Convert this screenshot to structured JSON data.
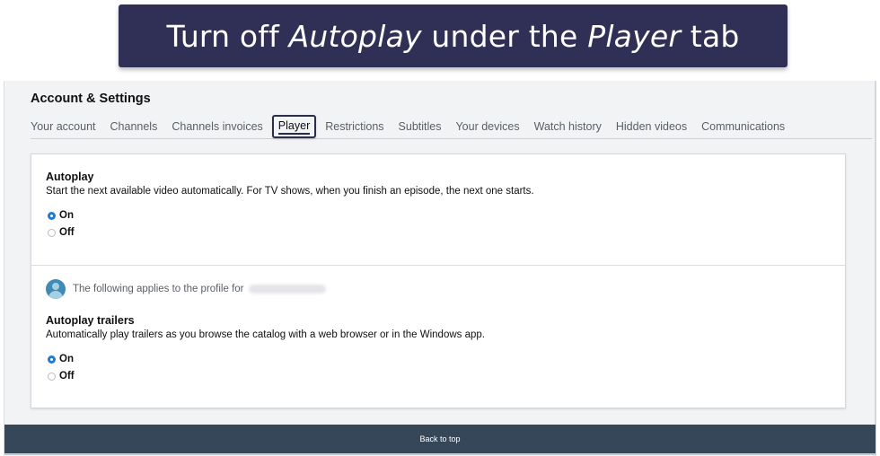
{
  "banner": {
    "part1": "Turn off ",
    "em1": "Autoplay",
    "part2": " under the ",
    "em2": "Player",
    "part3": " tab"
  },
  "page": {
    "title": "Account & Settings"
  },
  "tabs": [
    {
      "label": "Your account",
      "active": false
    },
    {
      "label": "Channels",
      "active": false
    },
    {
      "label": "Channels invoices",
      "active": false
    },
    {
      "label": "Player",
      "active": true
    },
    {
      "label": "Restrictions",
      "active": false
    },
    {
      "label": "Subtitles",
      "active": false
    },
    {
      "label": "Your devices",
      "active": false
    },
    {
      "label": "Watch history",
      "active": false
    },
    {
      "label": "Hidden videos",
      "active": false
    },
    {
      "label": "Communications",
      "active": false
    }
  ],
  "autoplay": {
    "title": "Autoplay",
    "description": "Start the next available video automatically. For TV shows, when you finish an episode, the next one starts.",
    "options": [
      {
        "label": "On",
        "checked": true
      },
      {
        "label": "Off",
        "checked": false
      }
    ]
  },
  "profile": {
    "icon": "user-avatar-icon",
    "text": "The following applies to the profile for"
  },
  "autoplay_trailers": {
    "title": "Autoplay trailers",
    "description": "Automatically play trailers as you browse the catalog with a web browser or in the Windows app.",
    "options": [
      {
        "label": "On",
        "checked": true
      },
      {
        "label": "Off",
        "checked": false
      }
    ]
  },
  "footer": {
    "back_to_top": "Back to top"
  },
  "colors": {
    "banner_bg": "#302f55",
    "radio_accent": "#1f7ad1",
    "footer_bg": "#37475a",
    "page_bg": "#f2f3f5"
  }
}
